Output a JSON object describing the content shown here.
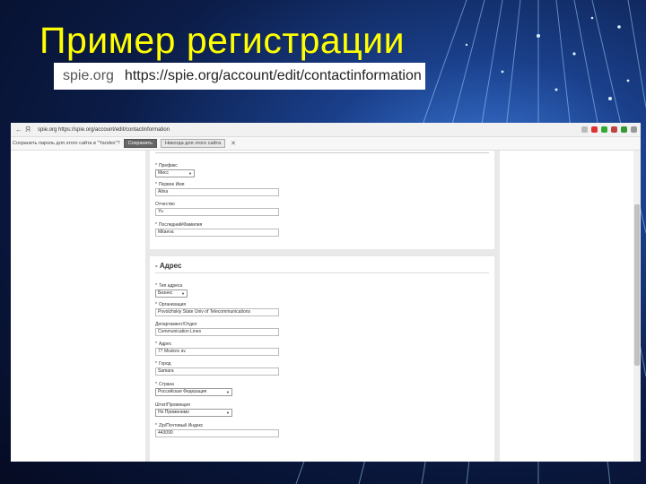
{
  "slide": {
    "title": "Пример регистрации"
  },
  "banner": {
    "domain": "spie.org",
    "url": "https://spie.org/account/edit/contactinformation"
  },
  "browser": {
    "nav_back": "←",
    "nav_yandex": "Я",
    "address": "spie.org   https://spie.org/account/edit/contactinformation",
    "passbar": {
      "message": "Сохранить пароль для этого сайта в \"Yandex\"?",
      "save_label": "Сохранить",
      "never_label": "Никогда для этого сайта",
      "close": "✕"
    }
  },
  "form": {
    "personal": {
      "prefix": {
        "label": "Префикс",
        "value": "Мисс"
      },
      "first_name": {
        "label": "Первое Имя",
        "value": "Alina"
      },
      "middle_name": {
        "label": "Отчество",
        "value": "Yu"
      },
      "last_name": {
        "label": "Последний/Фамилия",
        "value": "Mitaeva"
      }
    },
    "address_section": {
      "title": "- Адрес",
      "address_type": {
        "label": "Тип адреса",
        "value": "Бизнес"
      },
      "organization": {
        "label": "Организация",
        "value": "Povolzhskiy State Univ of Telecommunications"
      },
      "department": {
        "label": "Департамент/Отдел",
        "value": "Communication Lines"
      },
      "address": {
        "label": "Адрес",
        "value": "77 Moskov av"
      },
      "city": {
        "label": "Город",
        "value": "Samara"
      },
      "country": {
        "label": "Страна",
        "value": "Российская Федерация"
      },
      "state": {
        "label": "Штат/Провинция",
        "value": "Не Применимо"
      },
      "zip": {
        "label": "Zip/Почтовый Индекс",
        "value": "443090"
      }
    }
  },
  "colors": {
    "title": "#ffff00",
    "background": "#0b1c47"
  }
}
